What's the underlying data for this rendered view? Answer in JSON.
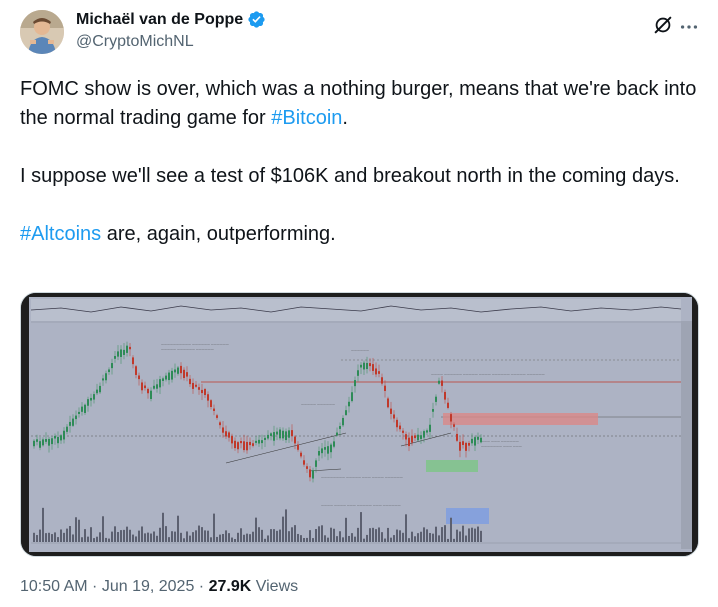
{
  "author": {
    "display_name": "Michaël van de Poppe",
    "handle": "@CryptoMichNL",
    "verified_icon": "verified-badge-icon",
    "brand_color": "#1d9bf0"
  },
  "tweet": {
    "line1_pre": "FOMC show is over, which was a nothing burger, means that we're  back into the normal trading game for ",
    "line1_hashtag": "#Bitcoin",
    "line1_post": ".",
    "line2": "I suppose we'll see a test of $106K and breakout north in the coming days.",
    "line3_hashtag": "#Altcoins",
    "line3_post": " are, again, outperforming."
  },
  "meta": {
    "time": "10:50 AM",
    "separator": " · ",
    "date": "Jun 19, 2025",
    "views_count": "27.9K",
    "views_label": " Views"
  },
  "icons": {
    "grok": "grok-icon",
    "more": "more-options-icon"
  },
  "chart_image": {
    "background": "#adb3c4",
    "candle_up": "#2e8b57",
    "candle_down": "#c0392b",
    "resistance_zone": "#d98888",
    "support_zone": "#7fc48a",
    "target_zone": "#7f9ee0"
  }
}
